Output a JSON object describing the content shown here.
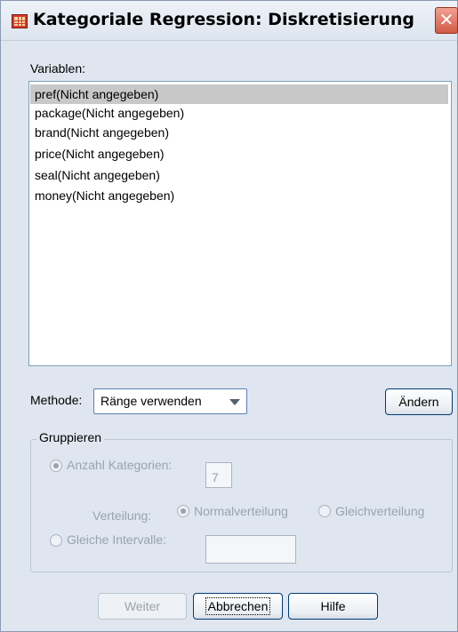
{
  "window": {
    "title": "Kategoriale Regression: Diskretisierung",
    "close_symbol": "✕",
    "icon": "spss-table-icon"
  },
  "variables": {
    "label": "Variablen:",
    "items": [
      {
        "label": "pref(Nicht angegeben)",
        "selected": true
      },
      {
        "label": "package(Nicht angegeben)",
        "selected": false
      },
      {
        "label": "brand(Nicht angegeben)",
        "selected": false
      },
      {
        "label": "price(Nicht angegeben)",
        "selected": false
      },
      {
        "label": "seal(Nicht angegeben)",
        "selected": false
      },
      {
        "label": "money(Nicht angegeben)",
        "selected": false
      }
    ]
  },
  "method": {
    "label": "Methode:",
    "selected": "Ränge verwenden",
    "change_button": "Ändern"
  },
  "grouping": {
    "title": "Gruppieren",
    "count_categories_label": "Anzahl Kategorien:",
    "count_categories_value": "7",
    "distribution_label": "Verteilung:",
    "normal_label": "Normalverteilung",
    "uniform_label": "Gleichverteilung",
    "equal_intervals_label": "Gleiche Intervalle:",
    "equal_intervals_value": ""
  },
  "buttons": {
    "continue": "Weiter",
    "cancel": "Abbrechen",
    "help": "Hilfe"
  },
  "colors": {
    "dialog_bg": "#dfe6ef",
    "selection": "#c8c8c8",
    "disabled_text": "#9aa3ad",
    "close_button": "#d25a44"
  }
}
